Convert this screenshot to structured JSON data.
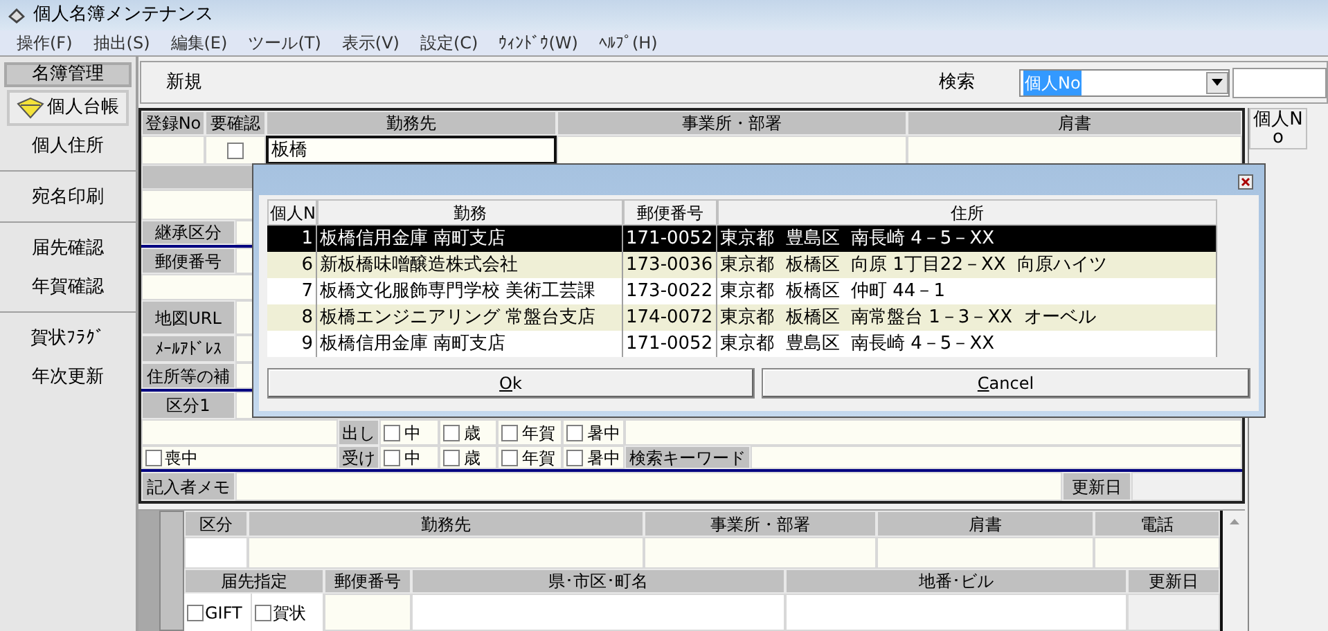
{
  "window": {
    "title": "個人名簿メンテナンス"
  },
  "menu": [
    "操作(F)",
    "抽出(S)",
    "編集(E)",
    "ツール(T)",
    "表示(V)",
    "設定(C)",
    "ｳｨﾝﾄﾞｳ(W)",
    "ﾍﾙﾌﾟ(H)"
  ],
  "sidebar": {
    "header": "名簿管理",
    "items": [
      {
        "label": "個人台帳",
        "selected": true,
        "separator_after": false
      },
      {
        "label": "個人住所",
        "selected": false,
        "separator_after": true
      },
      {
        "label": "宛名印刷",
        "selected": false,
        "separator_after": true
      },
      {
        "label": "届先確認",
        "selected": false,
        "separator_after": false
      },
      {
        "label": "年賀確認",
        "selected": false,
        "separator_after": true
      },
      {
        "label": "賀状ﾌﾗｸﾞ",
        "selected": false,
        "separator_after": false
      },
      {
        "label": "年次更新",
        "selected": false,
        "separator_after": false
      }
    ]
  },
  "toolbar": {
    "mode": "新規",
    "search_label": "検索",
    "search_field": "個人No"
  },
  "record_grid": {
    "columns": [
      "登録No",
      "要確認",
      "勤務先",
      "事業所・部署",
      "肩書"
    ],
    "needs_check": false,
    "workplace": "板橋"
  },
  "side_list": {
    "column": "個人No"
  },
  "form": {
    "labels": [
      "継承区分",
      "郵便番号",
      "地図URL",
      "ﾒｰﾙｱﾄﾞﾚｽ",
      "住所等の補",
      "区分1"
    ],
    "mourning": {
      "label": "喪中",
      "checked": false
    },
    "send": {
      "label": "出し",
      "checks": [
        {
          "label": "中",
          "checked": false
        },
        {
          "label": "歳",
          "checked": false
        },
        {
          "label": "年賀",
          "checked": false
        },
        {
          "label": "暑中",
          "checked": false
        }
      ]
    },
    "receive": {
      "label": "受け",
      "checks": [
        {
          "label": "中",
          "checked": false
        },
        {
          "label": "歳",
          "checked": false
        },
        {
          "label": "年賀",
          "checked": false
        },
        {
          "label": "暑中",
          "checked": false
        }
      ]
    },
    "keyword_label": "検索キーワード",
    "memo_label": "記入者メモ",
    "updated_label": "更新日"
  },
  "delivery": {
    "columns": [
      "区分",
      "勤務先",
      "事業所・部署",
      "肩書",
      "電話"
    ],
    "columns_2": [
      "届先指定",
      "郵便番号",
      "県･市区･町名",
      "地番･ビル",
      "更新日"
    ],
    "checks": [
      {
        "label": "GIFT",
        "checked": false
      },
      {
        "label": "賀状",
        "checked": false
      }
    ]
  },
  "dialog": {
    "columns": [
      "個人N",
      "勤務",
      "郵便番号",
      "住所"
    ],
    "rows": [
      {
        "no": "1",
        "company": "板橋信用金庫 南町支店",
        "zip": "171-0052",
        "address": "東京都  豊島区  南長崎 4－5－XX",
        "selected": true
      },
      {
        "no": "6",
        "company": "新板橋味噌醸造株式会社",
        "zip": "173-0036",
        "address": "東京都  板橋区  向原 1丁目22－XX  向原ハイツ",
        "selected": false
      },
      {
        "no": "7",
        "company": "板橋文化服飾専門学校 美術工芸課",
        "zip": "173-0022",
        "address": "東京都  板橋区  仲町 44－1",
        "selected": false
      },
      {
        "no": "8",
        "company": "板橋エンジニアリング 常盤台支店",
        "zip": "174-0072",
        "address": "東京都  板橋区  南常盤台 1－3－XX  オーベル",
        "selected": false
      },
      {
        "no": "9",
        "company": "板橋信用金庫 南町支店",
        "zip": "171-0052",
        "address": "東京都  豊島区  南長崎 4－5－XX",
        "selected": false
      }
    ],
    "buttons": [
      "Ok",
      "Cancel"
    ]
  }
}
